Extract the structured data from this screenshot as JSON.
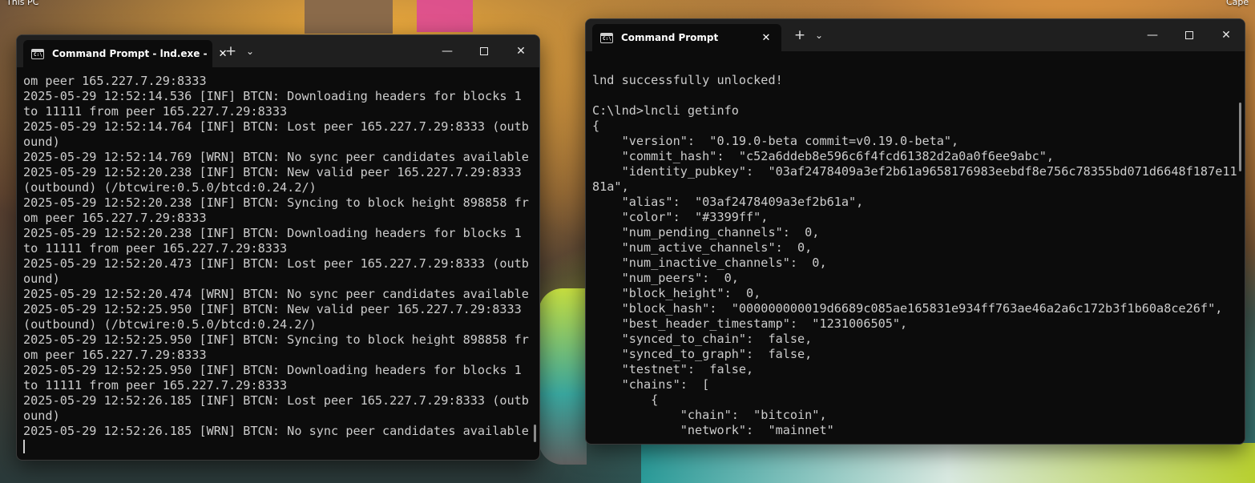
{
  "desktop": {
    "this_pc_label": "This PC",
    "corner_label": "Cape"
  },
  "left_window": {
    "tab_title": "Command Prompt - lnd.exe -",
    "lines": [
      "om peer 165.227.7.29:8333",
      "2025-05-29 12:52:14.536 [INF] BTCN: Downloading headers for blocks 1",
      "to 11111 from peer 165.227.7.29:8333",
      "2025-05-29 12:52:14.764 [INF] BTCN: Lost peer 165.227.7.29:8333 (outb",
      "ound)",
      "2025-05-29 12:52:14.769 [WRN] BTCN: No sync peer candidates available",
      "2025-05-29 12:52:20.238 [INF] BTCN: New valid peer 165.227.7.29:8333",
      "(outbound) (/btcwire:0.5.0/btcd:0.24.2/)",
      "2025-05-29 12:52:20.238 [INF] BTCN: Syncing to block height 898858 fr",
      "om peer 165.227.7.29:8333",
      "2025-05-29 12:52:20.238 [INF] BTCN: Downloading headers for blocks 1",
      "to 11111 from peer 165.227.7.29:8333",
      "2025-05-29 12:52:20.473 [INF] BTCN: Lost peer 165.227.7.29:8333 (outb",
      "ound)",
      "2025-05-29 12:52:20.474 [WRN] BTCN: No sync peer candidates available",
      "2025-05-29 12:52:25.950 [INF] BTCN: New valid peer 165.227.7.29:8333",
      "(outbound) (/btcwire:0.5.0/btcd:0.24.2/)",
      "2025-05-29 12:52:25.950 [INF] BTCN: Syncing to block height 898858 fr",
      "om peer 165.227.7.29:8333",
      "2025-05-29 12:52:25.950 [INF] BTCN: Downloading headers for blocks 1",
      "to 11111 from peer 165.227.7.29:8333",
      "2025-05-29 12:52:26.185 [INF] BTCN: Lost peer 165.227.7.29:8333 (outb",
      "ound)",
      "2025-05-29 12:52:26.185 [WRN] BTCN: No sync peer candidates available"
    ]
  },
  "right_window": {
    "tab_title": "Command Prompt",
    "lines": [
      "",
      "lnd successfully unlocked!",
      "",
      "C:\\lnd>lncli getinfo",
      "{",
      "    \"version\":  \"0.19.0-beta commit=v0.19.0-beta\",",
      "    \"commit_hash\":  \"c52a6ddeb8e596c6f4fcd61382d2a0a0f6ee9abc\",",
      "    \"identity_pubkey\":  \"03af2478409a3ef2b61a9658176983eebdf8e756c78355bd071d6648f187e11",
      "81a\",",
      "    \"alias\":  \"03af2478409a3ef2b61a\",",
      "    \"color\":  \"#3399ff\",",
      "    \"num_pending_channels\":  0,",
      "    \"num_active_channels\":  0,",
      "    \"num_inactive_channels\":  0,",
      "    \"num_peers\":  0,",
      "    \"block_height\":  0,",
      "    \"block_hash\":  \"000000000019d6689c085ae165831e934ff763ae46a2a6c172b3f1b60a8ce26f\",",
      "    \"best_header_timestamp\":  \"1231006505\",",
      "    \"synced_to_chain\":  false,",
      "    \"synced_to_graph\":  false,",
      "    \"testnet\":  false,",
      "    \"chains\":  [",
      "        {",
      "            \"chain\":  \"bitcoin\",",
      "            \"network\":  \"mainnet\""
    ]
  },
  "icons": {
    "tab_icon_text": "C:\\",
    "close": "✕",
    "new_tab": "+",
    "dropdown": "⌄",
    "minimize": "—"
  },
  "colors": {
    "terminal_bg": "#0c0c0c",
    "titlebar_bg": "#1f1f1f",
    "terminal_text": "#cccccc"
  }
}
